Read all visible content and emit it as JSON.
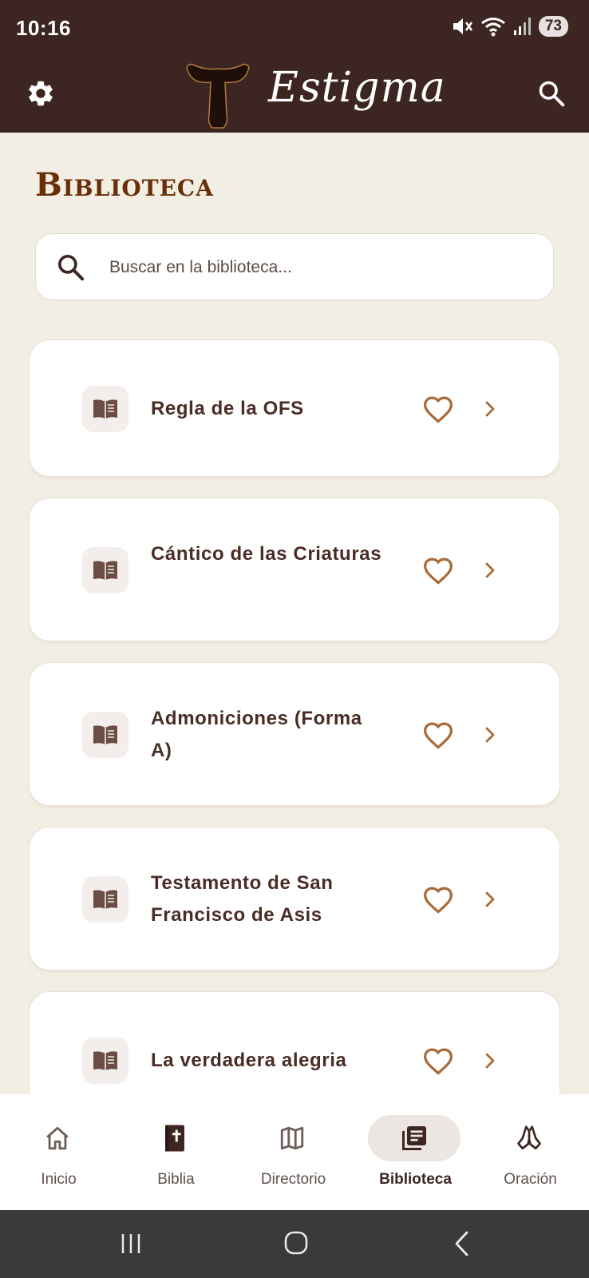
{
  "status_bar": {
    "time": "10:16",
    "battery": "73"
  },
  "app_bar": {
    "title": "Estigma"
  },
  "page": {
    "title": "Biblioteca"
  },
  "search": {
    "placeholder": "Buscar en la biblioteca..."
  },
  "library": {
    "items": [
      {
        "title": "Regla de la OFS"
      },
      {
        "title": "Cántico de las Criaturas"
      },
      {
        "title": "Admoniciones (Forma A)"
      },
      {
        "title": "Testamento de San Francisco de Asis"
      },
      {
        "title": "La verdadera alegria"
      }
    ]
  },
  "bottom_nav": {
    "items": [
      {
        "label": "Inicio",
        "icon": "home-icon"
      },
      {
        "label": "Biblia",
        "icon": "bible-icon"
      },
      {
        "label": "Directorio",
        "icon": "map-icon"
      },
      {
        "label": "Biblioteca",
        "icon": "library-icon",
        "active": true
      },
      {
        "label": "Oración",
        "icon": "praying-hands-icon"
      }
    ]
  },
  "colors": {
    "app_bar": "#3d2622",
    "background": "#f3eee4",
    "page_title": "#6a2f08",
    "accent": "#a86b3a",
    "card_text": "#4a2c26"
  }
}
